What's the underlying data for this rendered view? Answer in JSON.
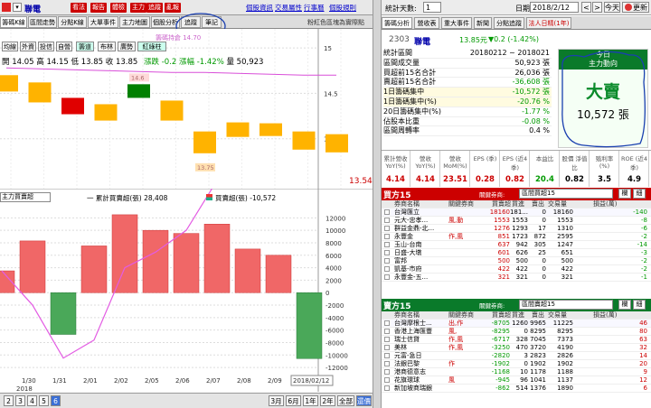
{
  "toolbar": {
    "stock_name": "聯電",
    "buttons": [
      "看法",
      "報告",
      "體檢",
      "主力",
      "追蹤",
      "亂報"
    ],
    "links": [
      "個股資訊",
      "交易屬性",
      "行事曆",
      "個股規則"
    ],
    "note": "粉紅色區塊為實際點"
  },
  "left_tabs": [
    "籌碼K線",
    "區間走勢",
    "分點K線",
    "大單事件",
    "主力地圖",
    "個股分析",
    "追蹤",
    "筆記"
  ],
  "ma_label": "籌碼持倉 14.70",
  "chart_buttons": [
    "均線",
    "外資",
    "投信",
    "自營",
    "籌道",
    "布林",
    "廣勢",
    "紅綠柱"
  ],
  "quote": {
    "open": "開 14.05",
    "high": "高 14.15",
    "low": "低 13.85",
    "close": "收 13.85",
    "change": "漲跌 -0.2",
    "pct": "漲幅 -1.42%",
    "volume": "量 50,923"
  },
  "lower_legend": {
    "dropdown": "主力買賣超",
    "cum": "一 累計買賣超(張) 28,408",
    "net": "買賣超(張) -10,572"
  },
  "chart_data": [
    {
      "type": "candlestick",
      "y_ticks": [
        "15",
        "14.5",
        "14",
        "13.54"
      ],
      "ylim": [
        13.5,
        15.15
      ],
      "x": [
        "1/29",
        "1/30",
        "1/31",
        "2/01",
        "2/02",
        "2/05",
        "2/06",
        "2/07",
        "2/08",
        "2/09",
        "2/12"
      ],
      "open": [
        14.7,
        14.62,
        14.45,
        14.38,
        14.45,
        14.42,
        14.08,
        14.18,
        14.17,
        14.08,
        14.05
      ],
      "close": [
        14.52,
        14.4,
        14.27,
        14.2,
        14.6,
        14.2,
        13.84,
        14.02,
        14.03,
        13.88,
        13.85
      ],
      "color": [
        "#ffb300",
        "#ffb300",
        "#e00000",
        "#ffb300",
        "#008000",
        "#ffb300",
        "#ffb300",
        "#ffb300",
        "#ffb300",
        "#ffb300",
        "#ffb300"
      ],
      "ma": [
        14.78,
        14.77,
        14.76,
        14.75,
        14.74,
        14.73,
        14.73,
        14.72,
        14.71,
        14.7,
        14.7
      ],
      "labels": [
        {
          "x": "2/02",
          "text": "14.6"
        },
        {
          "x": "2/06",
          "text": "13.75"
        }
      ],
      "last_price": "13.54"
    },
    {
      "type": "bar",
      "x": [
        "1/29",
        "1/30",
        "1/31",
        "2/01",
        "2/02",
        "2/05",
        "2/06",
        "2/07",
        "2/08",
        "2/09",
        "2/12"
      ],
      "net": [
        3500,
        8300,
        -6700,
        7500,
        12500,
        10000,
        9500,
        11000,
        7000,
        6000,
        -10572
      ],
      "cum": [
        3500,
        -2000,
        -10500,
        -7600,
        4000,
        6500,
        10000,
        18000,
        20500,
        25000,
        18000
      ],
      "y_ticks": [
        "12000",
        "10000",
        "8000",
        "6000",
        "4000",
        "2000",
        "0",
        "-2000",
        "-4000",
        "-6000",
        "-8000",
        "-10000",
        "-12000"
      ],
      "ylim": [
        -13000,
        13500
      ],
      "x_labels": [
        "1/30",
        "1/31",
        "2/01",
        "2/02",
        "2/05",
        "2/06",
        "2/07",
        "2/08",
        "2/09",
        "2018/02/12"
      ],
      "year_label": "2018"
    }
  ],
  "bottom_nav": {
    "pages": [
      "2",
      "3",
      "4",
      "5",
      "6"
    ],
    "ranges": [
      "3月",
      "6月",
      "1年",
      "2年",
      "全部",
      "還價"
    ]
  },
  "right": {
    "stat_days_label": "統計天數:",
    "stat_days_value": "1",
    "date_label": "日期:",
    "date_value": "2018/2/12",
    "today_btn": "今天",
    "refresh_btn": "更新",
    "tabs": [
      "籌碼分析",
      "營收表",
      "重大事件",
      "新聞",
      "分點追蹤",
      "法人日精(1年)"
    ],
    "stock_code": "2303",
    "stock_name": "聯電",
    "price": "13.85元",
    "change": "▼0.2 (-1.42%)",
    "summary": [
      {
        "label": "統計區間",
        "value": "20180212 ~ 2018021"
      },
      {
        "label": "區間成交量",
        "value": "50,923 張"
      },
      {
        "label": "買超前15名合計",
        "value": "26,036 張"
      },
      {
        "label": "賣超前15名合計",
        "value": "-36,608 張"
      },
      {
        "label": "1日籌碼集中",
        "value": "-10,572 張"
      },
      {
        "label": "1日籌碼集中(%)",
        "value": "-20.76 %"
      },
      {
        "label": "20日籌碼集中(%)",
        "value": "-1.77 %"
      },
      {
        "label": "佔股本比重",
        "value": "-0.08 %"
      },
      {
        "label": "區間周轉率",
        "value": "0.4 %"
      }
    ],
    "today_box": {
      "header1": "今日",
      "header2": "主力動向",
      "verdict": "大賣",
      "amount": "10,572 張"
    },
    "metrics": [
      {
        "label": "累計營收 YoY(%)",
        "value": "4.14"
      },
      {
        "label": "營收 YoY(%)",
        "value": "4.14"
      },
      {
        "label": "營收 MoM(%)",
        "value": "23.51"
      },
      {
        "label": "EPS (季)",
        "value": "0.28"
      },
      {
        "label": "EPS (近4季)",
        "value": "0.82"
      },
      {
        "label": "本益比",
        "value": "20.4"
      },
      {
        "label": "股價 淨值比",
        "value": "0.82"
      },
      {
        "label": "殖利率 (%)",
        "value": "3.5"
      },
      {
        "label": "ROE (近4季)",
        "value": "4.9"
      }
    ],
    "buy": {
      "title": "買方15",
      "hint": "關鍵券商:",
      "select": "區間買超15",
      "btn1": "欄",
      "btn2": "細",
      "headers": [
        "券商名稱",
        "關鍵券商",
        "買賣超",
        "買進",
        "賣出",
        "交易量",
        "損益(萬)"
      ],
      "rows": [
        [
          "台灣匯立",
          "",
          "18160",
          "181...",
          "0",
          "18160",
          "-140"
        ],
        [
          "元大-忠孝...",
          "風,動",
          "1553",
          "1553",
          "0",
          "1553",
          "-8"
        ],
        [
          "群益金鼎-北...",
          "",
          "1276",
          "1293",
          "17",
          "1310",
          "-6"
        ],
        [
          "永豐金",
          "作,風",
          "851",
          "1723",
          "872",
          "2595",
          "-2"
        ],
        [
          "玉山-台南",
          "",
          "637",
          "942",
          "305",
          "1247",
          "-14"
        ],
        [
          "日盛-大墩",
          "",
          "601",
          "626",
          "25",
          "651",
          "-3"
        ],
        [
          "富邦",
          "",
          "500",
          "500",
          "0",
          "500",
          "-2"
        ],
        [
          "凱基-市府",
          "",
          "422",
          "422",
          "0",
          "422",
          "-2"
        ],
        [
          "永豐金-五...",
          "",
          "321",
          "321",
          "0",
          "321",
          "-1"
        ]
      ]
    },
    "sell": {
      "title": "賣方15",
      "hint": "關鍵券商:",
      "select": "區間賣超15",
      "btn1": "欄",
      "btn2": "細",
      "headers": [
        "券商名稱",
        "關鍵券商",
        "買賣超",
        "買進",
        "賣出",
        "交易量",
        "損益(萬)"
      ],
      "rows": [
        [
          "台灣摩根士...",
          "出,作",
          "-8705",
          "1260",
          "9965",
          "11225",
          "46"
        ],
        [
          "香港上海匯豐",
          "風,",
          "-8295",
          "0",
          "8295",
          "8295",
          "80"
        ],
        [
          "瑞士信貸",
          "作,風",
          "-6717",
          "328",
          "7045",
          "7373",
          "63"
        ],
        [
          "美林",
          "作,風",
          "-3250",
          "470",
          "3720",
          "4190",
          "32"
        ],
        [
          "元富-急日",
          "",
          "-2820",
          "3",
          "2823",
          "2826",
          "14"
        ],
        [
          "法銀巴黎",
          "作",
          "-1902",
          "0",
          "1902",
          "1902",
          "20"
        ],
        [
          "港商德意志",
          "",
          "-1168",
          "10",
          "1178",
          "1188",
          "9"
        ],
        [
          "花旗環球",
          "風",
          "-945",
          "96",
          "1041",
          "1137",
          "12"
        ],
        [
          "新加坡商瑞銀",
          "",
          "-862",
          "514",
          "1376",
          "1890",
          "6"
        ]
      ]
    }
  }
}
